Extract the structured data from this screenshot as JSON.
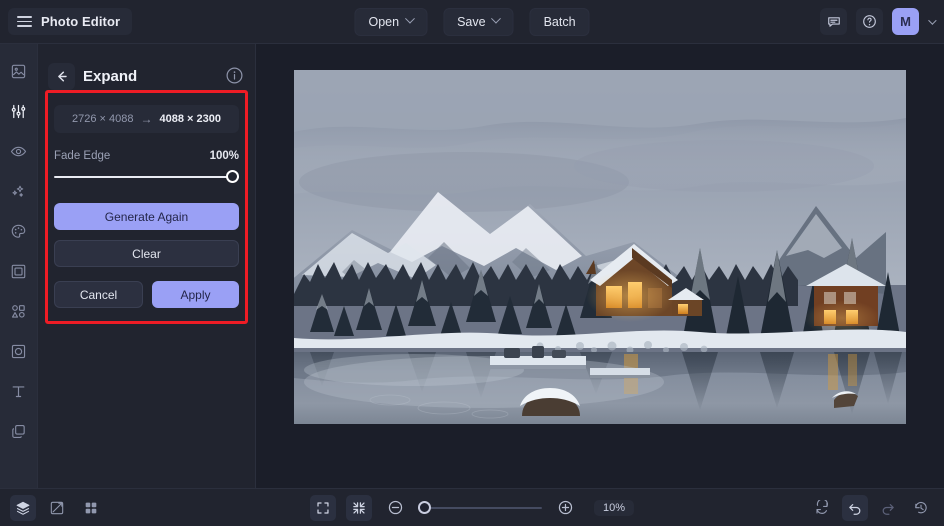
{
  "header": {
    "brand": "Photo Editor",
    "menu_icon": "hamburger-icon",
    "tools": [
      {
        "label": "Open",
        "has_caret": true
      },
      {
        "label": "Save",
        "has_caret": true
      },
      {
        "label": "Batch",
        "has_caret": false
      }
    ],
    "feedback_icon": "chat-icon",
    "help_icon": "help-circle-icon",
    "avatar_initial": "M"
  },
  "rail": {
    "items": [
      {
        "name": "image",
        "active": false
      },
      {
        "name": "adjustments",
        "active": true
      },
      {
        "name": "retouch-eye",
        "active": false
      },
      {
        "name": "effects-sparkle",
        "active": false
      },
      {
        "name": "color-palette",
        "active": false
      },
      {
        "name": "frame",
        "active": false
      },
      {
        "name": "shapes",
        "active": false
      },
      {
        "name": "transform",
        "active": false
      },
      {
        "name": "text",
        "active": false
      },
      {
        "name": "layers",
        "active": false
      }
    ]
  },
  "panel": {
    "title": "Expand",
    "back_icon": "arrow-left-icon",
    "info_icon": "info-circle-icon",
    "dimensions": {
      "from": "2726 × 4088",
      "arrow": "→",
      "to": "4088 × 2300"
    },
    "fade_edge": {
      "label": "Fade Edge",
      "value": "100%",
      "percent": 100
    },
    "buttons": {
      "generate_again": "Generate Again",
      "clear": "Clear",
      "cancel": "Cancel",
      "apply": "Apply"
    },
    "highlight_color": "#ee1c25"
  },
  "bottombar": {
    "left_icons": [
      {
        "name": "layers-icon",
        "active": true
      },
      {
        "name": "compare-icon",
        "active": false
      },
      {
        "name": "grid-icon",
        "active": false
      }
    ],
    "fit_icon": "fullscreen-icon",
    "shrink_icon": "fit-to-screen-icon",
    "zoom_out_icon": "zoom-out-icon",
    "zoom_in_icon": "zoom-in-icon",
    "zoom_level": "10%",
    "zoom_slider_percent": 0,
    "right_icons": [
      {
        "name": "reset-icon",
        "active": false,
        "dim": false
      },
      {
        "name": "undo-icon",
        "active": true,
        "dim": false
      },
      {
        "name": "redo-icon",
        "active": false,
        "dim": true
      },
      {
        "name": "history-icon",
        "active": false,
        "dim": false
      }
    ]
  },
  "canvas": {
    "image_alt": "Winter mountain lake with wooden lodge and snowy pine forest reflected in still water",
    "colors": {
      "sky": "#9aa3b3",
      "mountain": "#8f98a9",
      "snow": "#e8ecf2",
      "forest": "#2b3440",
      "water": "#747e90",
      "lodge_wood": "#7a4f30",
      "lodge_glow": "#f0a73c"
    }
  }
}
